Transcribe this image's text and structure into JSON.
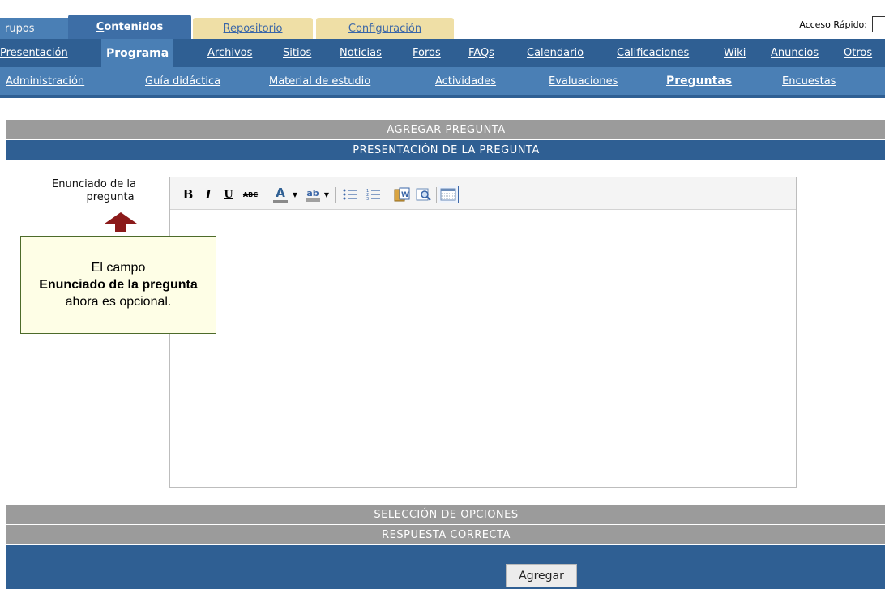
{
  "top_tabs": {
    "grupos": "rupos",
    "contenidos_first": "C",
    "contenidos_rest": "ontenidos",
    "repositorio": "Repositorio",
    "configuracion": "Configuración"
  },
  "quick_access": {
    "label": "Acceso Rápido:"
  },
  "nav2": {
    "items": [
      {
        "label": "Presentación"
      },
      {
        "label": "Programa",
        "active": true
      },
      {
        "label": "Archivos"
      },
      {
        "label": "Sitios"
      },
      {
        "label": "Noticias"
      },
      {
        "label": "Foros"
      },
      {
        "label": "FAQs"
      },
      {
        "label": "Calendario"
      },
      {
        "label": "Calificaciones"
      },
      {
        "label": "Wiki"
      },
      {
        "label": "Anuncios"
      },
      {
        "label": "Otros"
      }
    ]
  },
  "nav3": {
    "items": [
      {
        "label": "Administración"
      },
      {
        "label": "Guía didáctica"
      },
      {
        "label": "Material de estudio"
      },
      {
        "label": "Actividades"
      },
      {
        "label": "Evaluaciones"
      },
      {
        "label": "Preguntas",
        "active": true
      },
      {
        "label": "Encuestas"
      }
    ]
  },
  "form": {
    "title": "AGREGAR PREGUNTA",
    "section_presentation": "PRESENTACIÓN DE LA PREGUNTA",
    "field_label_line1": "Enunciado de la",
    "field_label_line2": "pregunta",
    "section_selection": "SELECCIÓN DE OPCIONES",
    "section_answer": "RESPUESTA CORRECTA",
    "submit_label": "Agregar"
  },
  "editor_toolbar": {
    "bold": "B",
    "italic": "I",
    "underline": "U",
    "strike": "ABC",
    "font_color": "A",
    "bg_color": "ab",
    "icons": [
      "bold-icon",
      "italic-icon",
      "underline-icon",
      "strikethrough-icon",
      "font-color-icon",
      "highlight-color-icon",
      "bullet-list-icon",
      "numbered-list-icon",
      "paste-word-icon",
      "preview-icon",
      "table-icon"
    ]
  },
  "tooltip": {
    "line1": "El campo",
    "bold": "Enunciado de la pregunta",
    "rest": " ahora es opcional."
  },
  "colors": {
    "nav_dark": "#2f5f93",
    "nav_light": "#4a7fb5",
    "tab_tan": "#efdfa6",
    "bar_gray": "#9b9b9b",
    "tooltip_bg": "#fefee6",
    "arrow": "#8b1a1a"
  }
}
